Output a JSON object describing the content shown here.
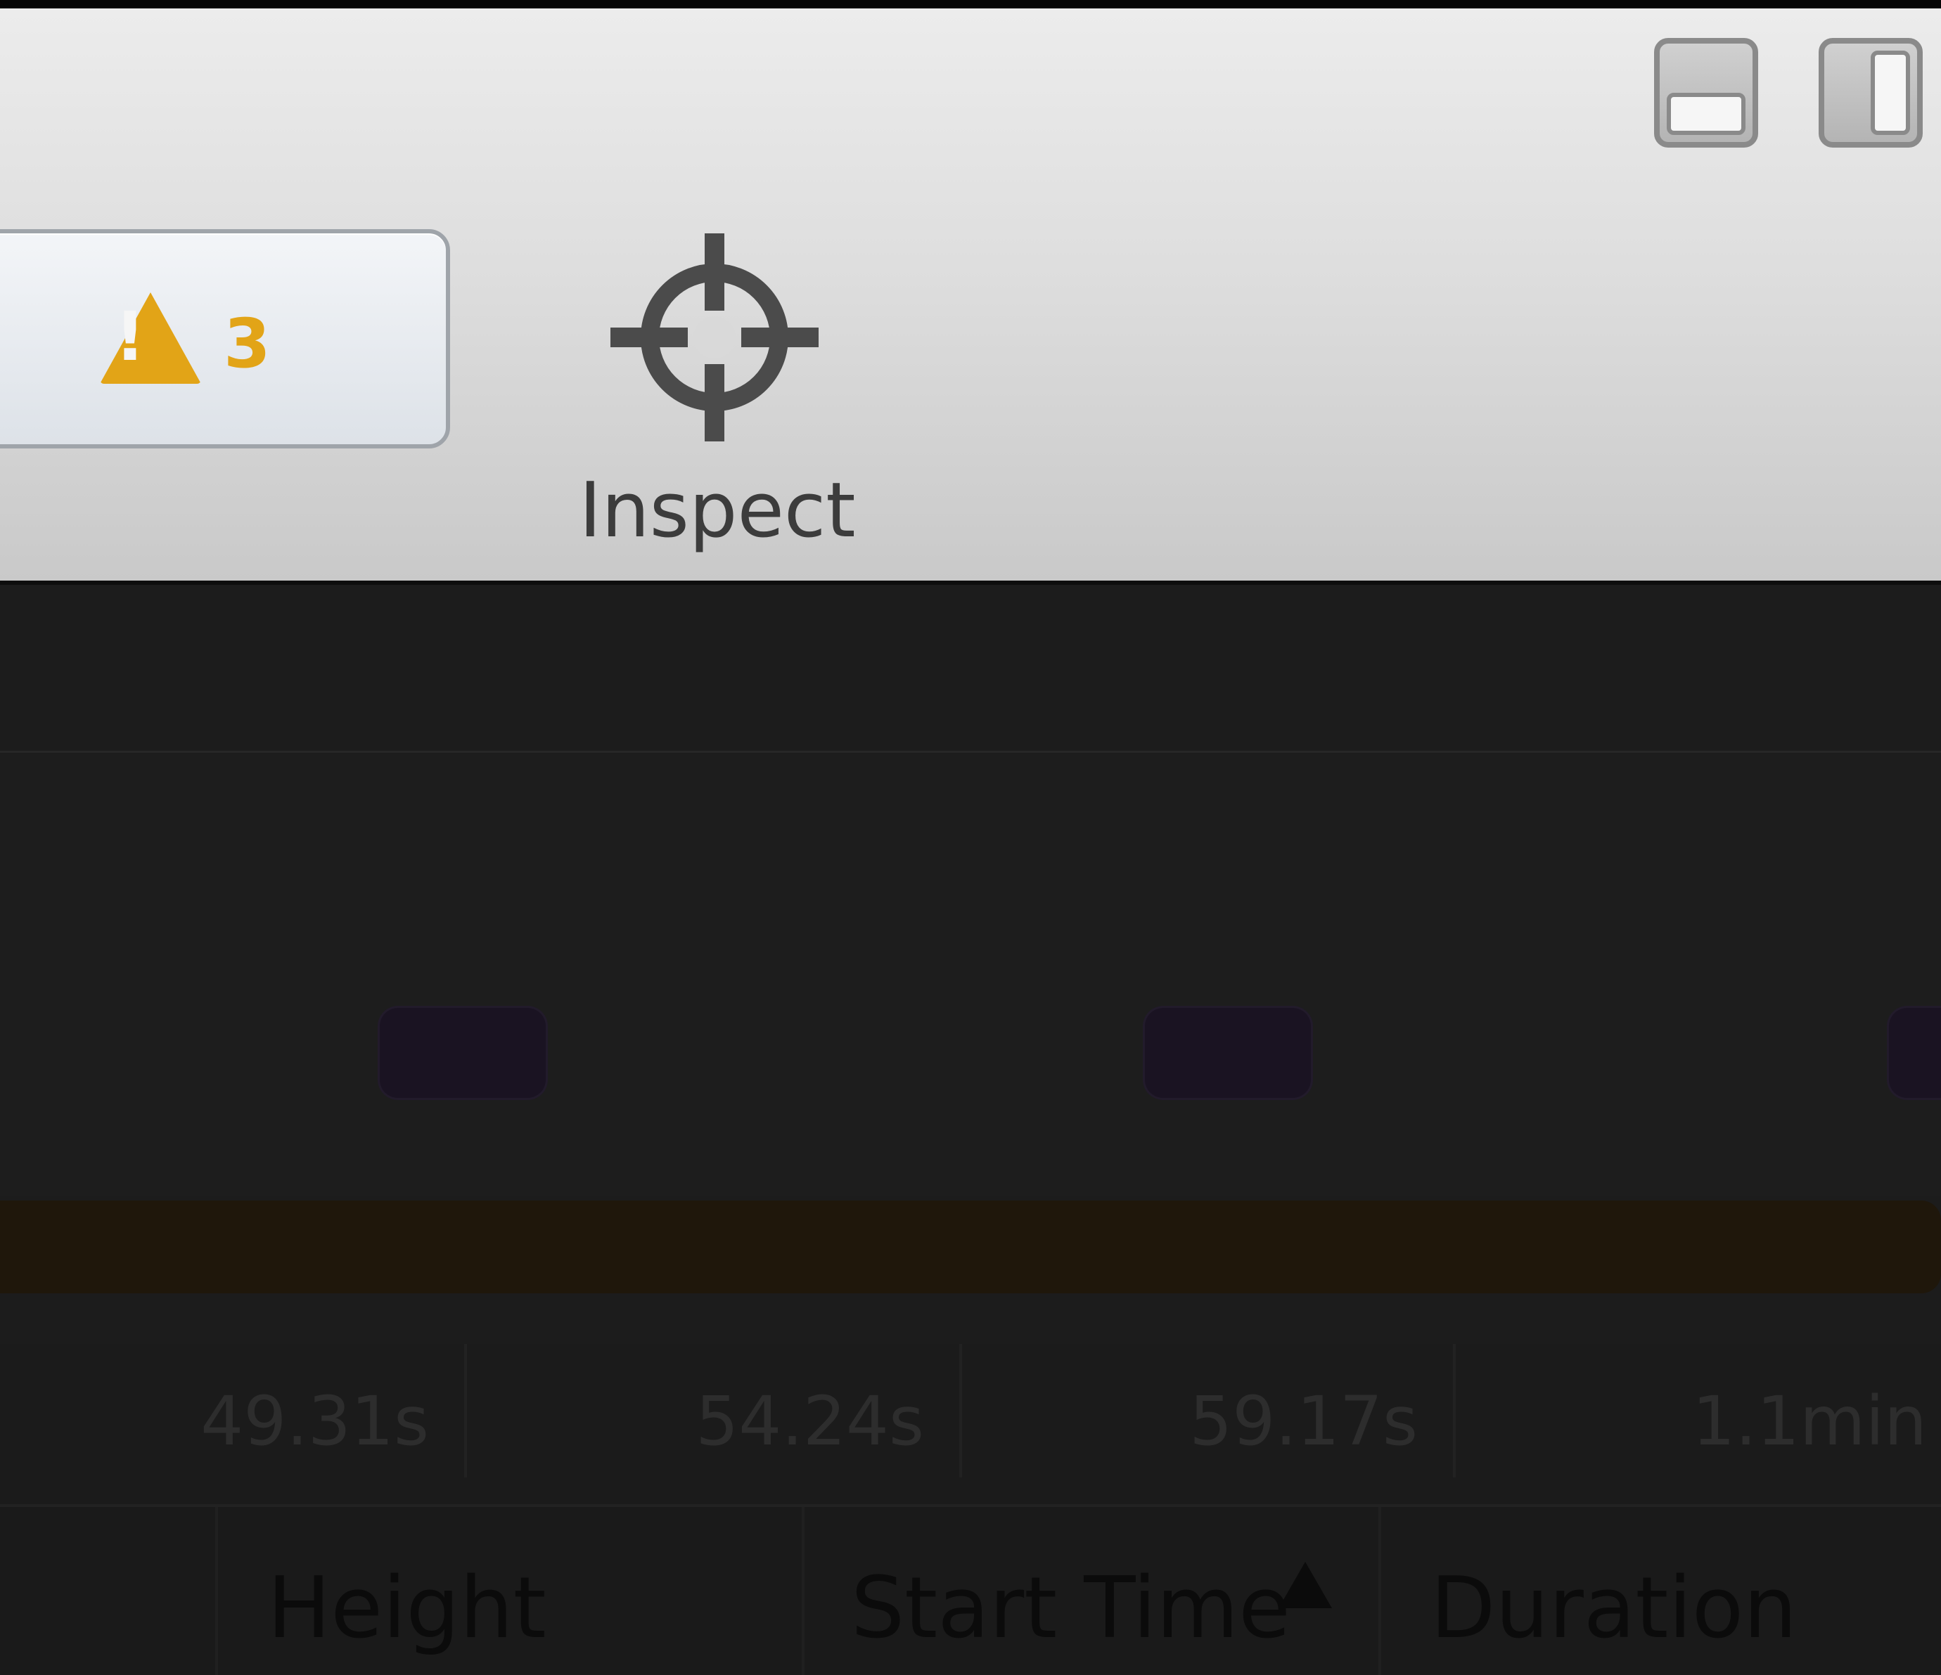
{
  "toolbar": {
    "issues": {
      "warning_mark": "!",
      "warning_count": "3",
      "warning_color": "#e2a417"
    },
    "inspect": {
      "label": "Inspect",
      "icon": "crosshair-icon"
    },
    "layout_buttons": [
      {
        "icon": "dock-bottom-icon"
      },
      {
        "icon": "dock-right-icon"
      }
    ]
  },
  "timeline": {
    "ruler_labels": [
      "49.31s",
      "54.24s",
      "59.17s",
      "1.1min"
    ]
  },
  "table": {
    "columns": [
      "Height",
      "Start Time",
      "Duration"
    ],
    "sorted_column": "Start Time",
    "sort_direction": "ascending"
  },
  "colors": {
    "toolbar_bg": "#dedede",
    "timeline_bg": "#1c1c1c",
    "event_block": "#1a1322",
    "progress_bar": "#1f170b"
  }
}
